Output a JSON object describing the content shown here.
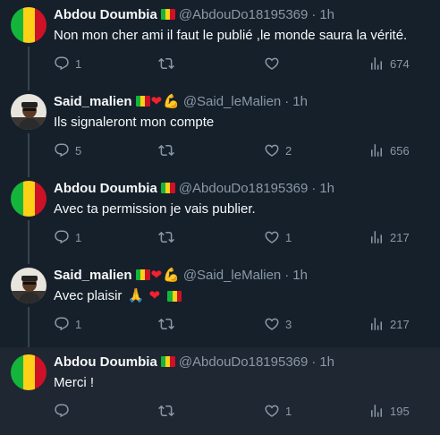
{
  "tweets": [
    {
      "name": "Abdou Doumbia",
      "handle": "@AbdouDo18195369",
      "time": "1h",
      "text": "Non mon cher ami il faut le publié ,le monde saura la vérité.",
      "reply_count": "1",
      "retweet_count": "",
      "like_count": "",
      "view_count": "674",
      "avatar": "mali-flag-avatar"
    },
    {
      "name": "Said_malien",
      "handle": "@Said_leMalien",
      "time": "1h",
      "text": "Ils signaleront mon compte",
      "reply_count": "5",
      "retweet_count": "",
      "like_count": "2",
      "view_count": "656",
      "avatar": "person-photo-avatar"
    },
    {
      "name": "Abdou Doumbia",
      "handle": "@AbdouDo18195369",
      "time": "1h",
      "text": "Avec ta permission je vais publier.",
      "reply_count": "1",
      "retweet_count": "",
      "like_count": "1",
      "view_count": "217",
      "avatar": "mali-flag-avatar"
    },
    {
      "name": "Said_malien",
      "handle": "@Said_leMalien",
      "time": "1h",
      "text": "Avec plaisir",
      "reply_count": "1",
      "retweet_count": "",
      "like_count": "3",
      "view_count": "217",
      "avatar": "person-photo-avatar"
    },
    {
      "name": "Abdou Doumbia",
      "handle": "@AbdouDo18195369",
      "time": "1h",
      "text": "Merci !",
      "reply_count": "",
      "retweet_count": "",
      "like_count": "1",
      "view_count": "195",
      "avatar": "mali-flag-avatar"
    }
  ],
  "separator": "·",
  "emoji": {
    "heart": "❤",
    "muscle": "💪",
    "pray": "🙏"
  },
  "colors": {
    "background": "#15202b",
    "highlight_background": "#1e2732",
    "secondary_text": "#8b98a5",
    "primary_text": "#f7f9f9",
    "thread_line": "#38444d",
    "mali_green": "#14b53a",
    "mali_yellow": "#fcd116",
    "mali_red": "#ce1126"
  },
  "icons": [
    "reply-icon",
    "retweet-icon",
    "like-icon",
    "views-icon",
    "mali-flag-icon",
    "heart-icon",
    "flexed-biceps-icon",
    "folded-hands-icon"
  ]
}
